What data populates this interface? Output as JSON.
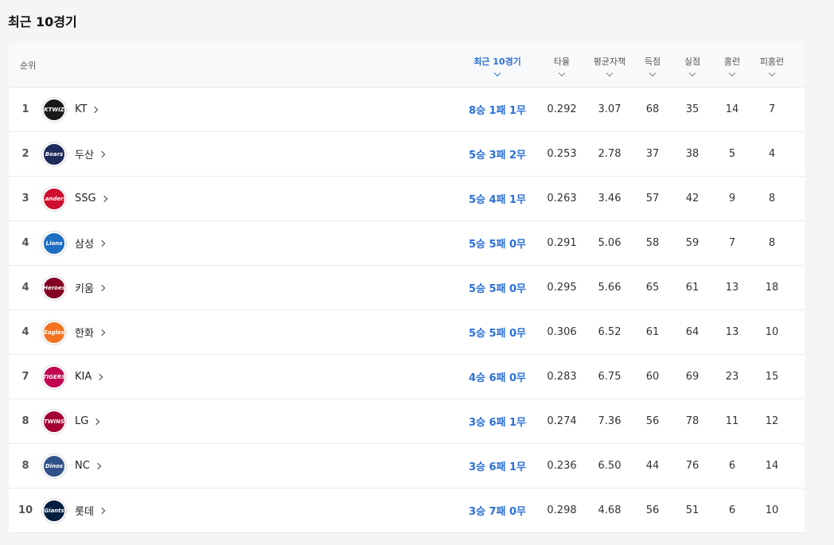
{
  "title": "최근 10경기",
  "headers": {
    "rank": "순위",
    "recent10": "최근 10경기",
    "avg": "타율",
    "era": "평균자책",
    "runs_scored": "득점",
    "runs_allowed": "실점",
    "hr": "홈런",
    "hr_allowed": "피홈런"
  },
  "rows": [
    {
      "rank": "1",
      "team": "KT",
      "logo": "KTWIZ",
      "logo_color": "#1a1a1a",
      "record": "8승 1패 1무",
      "avg": "0.292",
      "era": "3.07",
      "rs": "68",
      "ra": "35",
      "hr": "14",
      "hra": "7"
    },
    {
      "rank": "2",
      "team": "두산",
      "logo": "Bears",
      "logo_color": "#1f2a5c",
      "record": "5승 3패 2무",
      "avg": "0.253",
      "era": "2.78",
      "rs": "37",
      "ra": "38",
      "hr": "5",
      "hra": "4"
    },
    {
      "rank": "3",
      "team": "SSG",
      "logo": "Landers",
      "logo_color": "#ce0e2d",
      "record": "5승 4패 1무",
      "avg": "0.263",
      "era": "3.46",
      "rs": "57",
      "ra": "42",
      "hr": "9",
      "hra": "8"
    },
    {
      "rank": "4",
      "team": "삼성",
      "logo": "Lions",
      "logo_color": "#1e6fc4",
      "record": "5승 5패 0무",
      "avg": "0.291",
      "era": "5.06",
      "rs": "58",
      "ra": "59",
      "hr": "7",
      "hra": "8"
    },
    {
      "rank": "4",
      "team": "키움",
      "logo": "Heroes",
      "logo_color": "#820024",
      "record": "5승 5패 0무",
      "avg": "0.295",
      "era": "5.66",
      "rs": "65",
      "ra": "61",
      "hr": "13",
      "hra": "18"
    },
    {
      "rank": "4",
      "team": "한화",
      "logo": "Eagles",
      "logo_color": "#f37321",
      "record": "5승 5패 0무",
      "avg": "0.306",
      "era": "6.52",
      "rs": "61",
      "ra": "64",
      "hr": "13",
      "hra": "10"
    },
    {
      "rank": "7",
      "team": "KIA",
      "logo": "TIGERS",
      "logo_color": "#c30452",
      "record": "4승 6패 0무",
      "avg": "0.283",
      "era": "6.75",
      "rs": "60",
      "ra": "69",
      "hr": "23",
      "hra": "15"
    },
    {
      "rank": "8",
      "team": "LG",
      "logo": "TWINS",
      "logo_color": "#a50034",
      "record": "3승 6패 1무",
      "avg": "0.274",
      "era": "7.36",
      "rs": "56",
      "ra": "78",
      "hr": "11",
      "hra": "12"
    },
    {
      "rank": "8",
      "team": "NC",
      "logo": "Dinos",
      "logo_color": "#315288",
      "record": "3승 6패 1무",
      "avg": "0.236",
      "era": "6.50",
      "rs": "44",
      "ra": "76",
      "hr": "6",
      "hra": "14"
    },
    {
      "rank": "10",
      "team": "롯데",
      "logo": "Giants",
      "logo_color": "#041e42",
      "record": "3승 7패 0무",
      "avg": "0.298",
      "era": "4.68",
      "rs": "56",
      "ra": "51",
      "hr": "6",
      "hra": "10"
    }
  ]
}
